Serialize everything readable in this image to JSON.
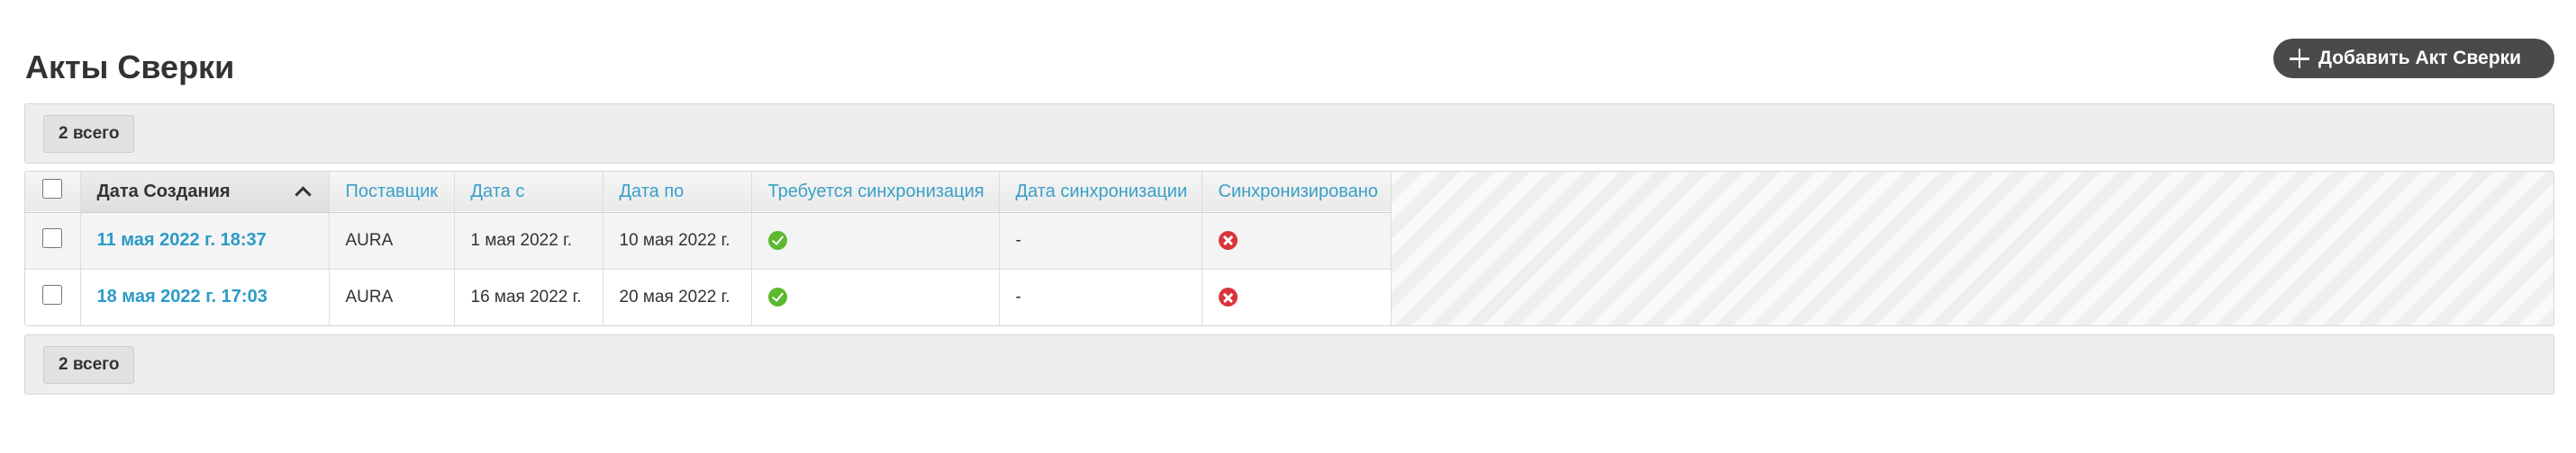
{
  "page": {
    "title": "Акты Сверки",
    "add_button_label": "Добавить Акт Сверки"
  },
  "toolbar_top": {
    "count_label": "2 всего"
  },
  "toolbar_bottom": {
    "count_label": "2 всего"
  },
  "table": {
    "columns": [
      {
        "key": "created",
        "label": "Дата Создания",
        "sorted": "asc"
      },
      {
        "key": "supplier",
        "label": "Поставщик"
      },
      {
        "key": "date_from",
        "label": "Дата с"
      },
      {
        "key": "date_to",
        "label": "Дата по"
      },
      {
        "key": "sync_required",
        "label": "Требуется синхронизация"
      },
      {
        "key": "sync_date",
        "label": "Дата синхронизации"
      },
      {
        "key": "synced",
        "label": "Синхронизировано"
      }
    ],
    "rows": [
      {
        "created": "11 мая 2022 г. 18:37",
        "supplier": "AURA",
        "date_from": "1 мая 2022 г.",
        "date_to": "10 мая 2022 г.",
        "sync_required": "check-circle-icon",
        "sync_date": "-",
        "synced": "cross-circle-icon"
      },
      {
        "created": "18 мая 2022 г. 17:03",
        "supplier": "AURA",
        "date_from": "16 мая 2022 г.",
        "date_to": "20 мая 2022 г.",
        "sync_required": "check-circle-icon",
        "sync_date": "-",
        "synced": "cross-circle-icon"
      }
    ]
  },
  "colors": {
    "link": "#2b9ac6",
    "header_link": "#3aa0c8",
    "button_bg": "#4a4a4a",
    "ok": "#5cb82e",
    "error": "#d9343a"
  }
}
